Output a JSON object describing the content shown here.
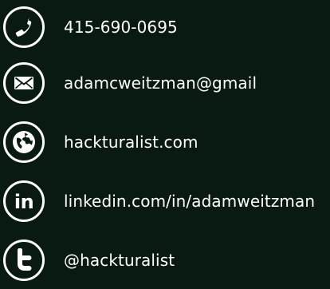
{
  "contacts": [
    {
      "icon": "phone-icon",
      "text": "415-690-0695"
    },
    {
      "icon": "envelope-icon",
      "text": "adamcweitzman@gmail"
    },
    {
      "icon": "globe-icon",
      "text": "hackturalist.com"
    },
    {
      "icon": "linkedin-icon",
      "text": "linkedin.com/in/adamweitzman",
      "glyph": "in"
    },
    {
      "icon": "twitter-icon",
      "text": "@hackturalist"
    }
  ],
  "colors": {
    "background": "#091a12",
    "foreground": "#ffffff"
  }
}
